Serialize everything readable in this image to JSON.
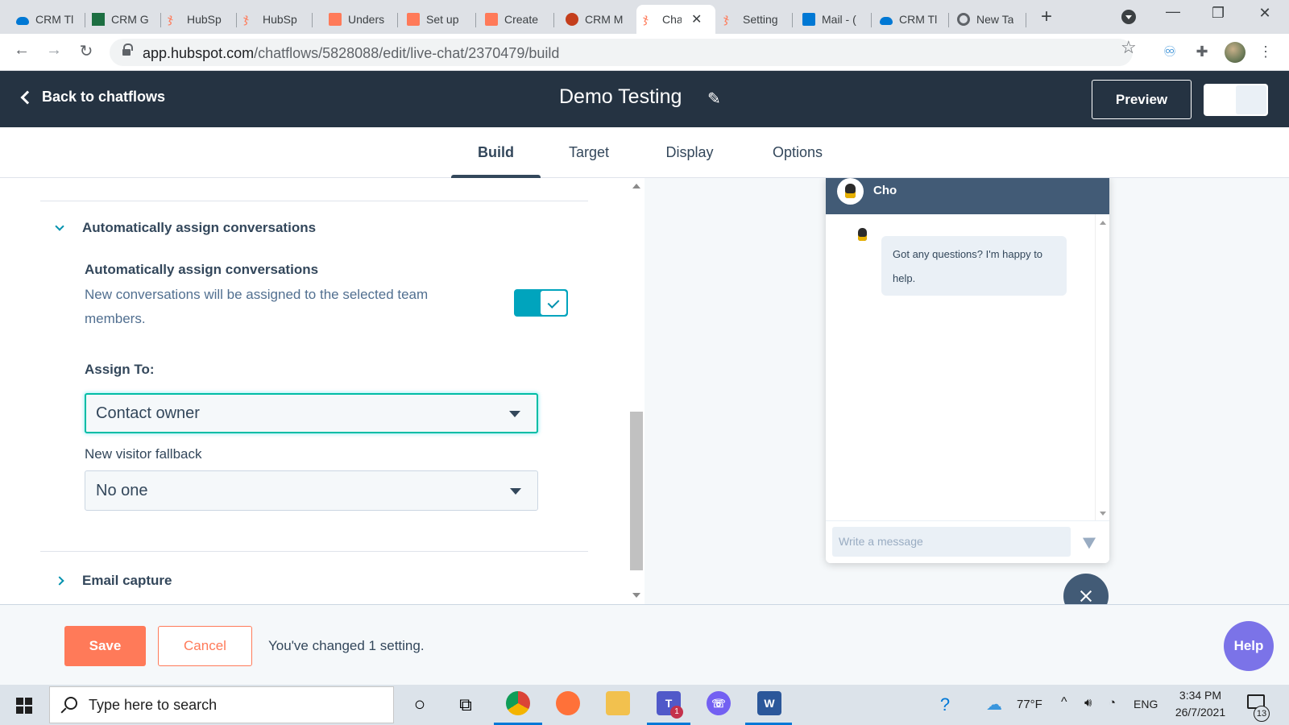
{
  "browser": {
    "tabs": [
      {
        "label": "CRM Tl",
        "icon": "cloud-icon",
        "color": "#0078d4"
      },
      {
        "label": "CRM G",
        "icon": "excel-icon",
        "color": "#1d6f42"
      },
      {
        "label": "HubSp",
        "icon": "hubspot-icon",
        "color": "#ff7a59"
      },
      {
        "label": "HubSp",
        "icon": "hubspot-icon",
        "color": "#ff7a59"
      },
      {
        "label": "Unders",
        "icon": "hubspot-academy-icon",
        "color": "#ff7a59"
      },
      {
        "label": "Set up",
        "icon": "hubspot-academy-icon",
        "color": "#ff7a59"
      },
      {
        "label": "Create",
        "icon": "hubspot-academy-icon",
        "color": "#ff7a59"
      },
      {
        "label": "CRM M",
        "icon": "powerpoint-icon",
        "color": "#c43e1c"
      },
      {
        "label": "Cha",
        "icon": "hubspot-icon",
        "color": "#ff7a59",
        "active": true
      },
      {
        "label": "Setting",
        "icon": "hubspot-icon",
        "color": "#ff7a59"
      },
      {
        "label": "Mail - (",
        "icon": "outlook-icon",
        "color": "#0078d4"
      },
      {
        "label": "CRM Tl",
        "icon": "cloud-icon",
        "color": "#0078d4"
      },
      {
        "label": "New Ta",
        "icon": "chrome-icon",
        "color": "#5f6368"
      }
    ],
    "url_host": "app.hubspot.com",
    "url_path": "/chatflows/5828088/edit/live-chat/2370479/build"
  },
  "header": {
    "back_label": "Back to chatflows",
    "title": "Demo Testing",
    "preview_label": "Preview"
  },
  "tabs": [
    {
      "label": "Build",
      "active": true
    },
    {
      "label": "Target",
      "active": false
    },
    {
      "label": "Display",
      "active": false
    },
    {
      "label": "Options",
      "active": false
    }
  ],
  "settings": {
    "section_title": "Automatically assign conversations",
    "setting_title": "Automatically assign conversations",
    "setting_desc": "New conversations will be assigned to the selected team members.",
    "toggle_on": true,
    "assign_to_label": "Assign To:",
    "assign_to_value": "Contact owner",
    "fallback_label": "New visitor fallback",
    "fallback_value": "No one",
    "next_section_title": "Email capture"
  },
  "chat_preview": {
    "agent_name": "Cho",
    "message": "Got any questions? I'm happy to help.",
    "input_placeholder": "Write a message"
  },
  "footer": {
    "save_label": "Save",
    "cancel_label": "Cancel",
    "status_text": "You've changed 1 setting.",
    "help_label": "Help"
  },
  "taskbar": {
    "search_placeholder": "Type here to search",
    "temperature": "77°F",
    "language": "ENG",
    "time": "3:34 PM",
    "date": "26/7/2021",
    "notification_count": "13",
    "teams_badge": "1"
  }
}
